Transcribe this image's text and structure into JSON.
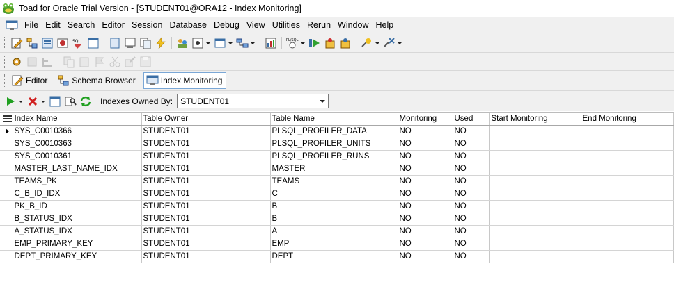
{
  "window": {
    "title": "Toad for Oracle Trial Version - [STUDENT01@ORA12 - Index Monitoring]",
    "app_icon": "toad-frog-icon"
  },
  "menu": [
    "File",
    "Edit",
    "Search",
    "Editor",
    "Session",
    "Database",
    "Debug",
    "View",
    "Utilities",
    "Rerun",
    "Window",
    "Help"
  ],
  "toolbar1": {
    "plsql_badge": "SQL",
    "plsql_badge2": "PL/SQL"
  },
  "tabs": [
    {
      "label": "Editor",
      "icon": "editor-icon"
    },
    {
      "label": "Schema Browser",
      "icon": "schema-browser-icon"
    },
    {
      "label": "Index Monitoring",
      "icon": "index-monitoring-icon",
      "active": true
    }
  ],
  "filter": {
    "label": "Indexes Owned By:",
    "value": "STUDENT01"
  },
  "grid": {
    "columns": [
      "Index Name",
      "Table Owner",
      "Table Name",
      "Monitoring",
      "Used",
      "Start Monitoring",
      "End Monitoring"
    ],
    "rows": [
      [
        "SYS_C0010366",
        "STUDENT01",
        "PLSQL_PROFILER_DATA",
        "NO",
        "NO",
        "",
        ""
      ],
      [
        "SYS_C0010363",
        "STUDENT01",
        "PLSQL_PROFILER_UNITS",
        "NO",
        "NO",
        "",
        ""
      ],
      [
        "SYS_C0010361",
        "STUDENT01",
        "PLSQL_PROFILER_RUNS",
        "NO",
        "NO",
        "",
        ""
      ],
      [
        "MASTER_LAST_NAME_IDX",
        "STUDENT01",
        "MASTER",
        "NO",
        "NO",
        "",
        ""
      ],
      [
        "TEAMS_PK",
        "STUDENT01",
        "TEAMS",
        "NO",
        "NO",
        "",
        ""
      ],
      [
        "C_B_ID_IDX",
        "STUDENT01",
        "C",
        "NO",
        "NO",
        "",
        ""
      ],
      [
        "PK_B_ID",
        "STUDENT01",
        "B",
        "NO",
        "NO",
        "",
        ""
      ],
      [
        "B_STATUS_IDX",
        "STUDENT01",
        "B",
        "NO",
        "NO",
        "",
        ""
      ],
      [
        "A_STATUS_IDX",
        "STUDENT01",
        "A",
        "NO",
        "NO",
        "",
        ""
      ],
      [
        "EMP_PRIMARY_KEY",
        "STUDENT01",
        "EMP",
        "NO",
        "NO",
        "",
        ""
      ],
      [
        "DEPT_PRIMARY_KEY",
        "STUDENT01",
        "DEPT",
        "NO",
        "NO",
        "",
        ""
      ]
    ],
    "selected_row": 0
  }
}
